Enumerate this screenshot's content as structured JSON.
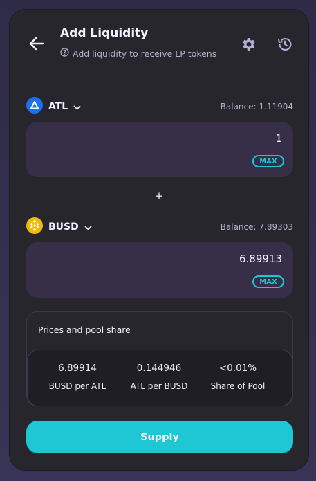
{
  "header": {
    "title": "Add Liquidity",
    "subtitle": "Add liquidity to receive LP tokens"
  },
  "token_a": {
    "symbol": "ATL",
    "balance": "Balance: 1.11904",
    "amount": "1",
    "max_label": "MAX"
  },
  "plus_sign": "+",
  "token_b": {
    "symbol": "BUSD",
    "balance": "Balance: 7.89303",
    "amount": "6.89913",
    "max_label": "MAX"
  },
  "pool": {
    "title": "Prices and pool share",
    "stats": [
      {
        "value": "6.89914",
        "label": "BUSD per ATL"
      },
      {
        "value": "0.144946",
        "label": "ATL per BUSD"
      },
      {
        "value": "<0.01%",
        "label": "Share of Pool"
      }
    ]
  },
  "supply_label": "Supply",
  "colors": {
    "accent": "#1fc7d4",
    "card": "#27262c",
    "input": "#372f47",
    "atl_brand": "#1c6ff0",
    "busd_brand": "#f0b90b"
  }
}
